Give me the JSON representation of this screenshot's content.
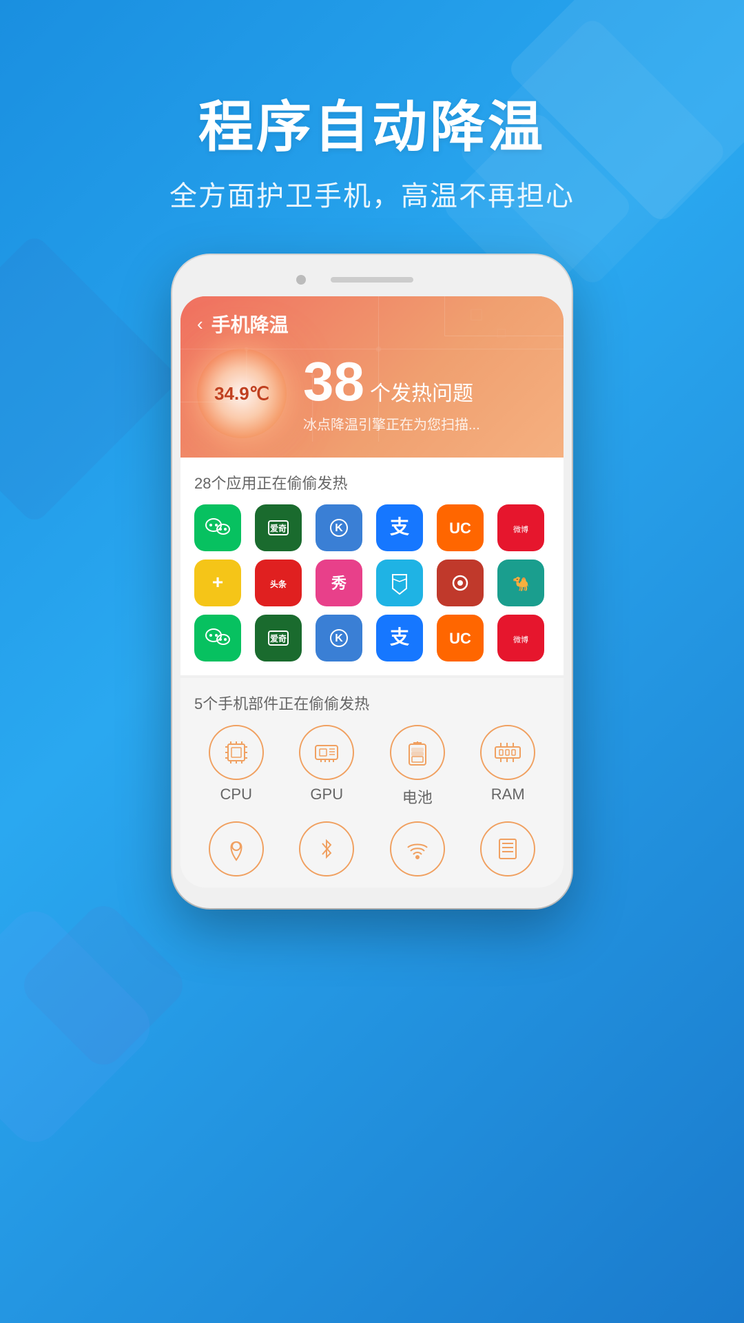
{
  "background": {
    "gradient_start": "#1a8fe0",
    "gradient_end": "#1a7acc"
  },
  "hero": {
    "title": "程序自动降温",
    "subtitle": "全方面护卫手机，高温不再担心"
  },
  "phone": {
    "header": {
      "back_label": "‹",
      "title": "手机降温",
      "temperature": "34.9℃",
      "issue_count": "38",
      "issue_label": "个发热问题",
      "issue_desc": "冰点降温引擎正在为您扫描..."
    },
    "apps_section": {
      "title": "28个应用正在偷偷发热",
      "apps": [
        {
          "name": "wechat",
          "emoji": "💬",
          "color": "#07c160"
        },
        {
          "name": "iqiyi",
          "emoji": "📺",
          "color": "#1a6b2e"
        },
        {
          "name": "kuwo",
          "emoji": "🎵",
          "color": "#3a7fd5"
        },
        {
          "name": "alipay",
          "emoji": "💳",
          "color": "#1677ff"
        },
        {
          "name": "uc",
          "emoji": "🌐",
          "color": "#ff6600"
        },
        {
          "name": "weibo",
          "emoji": "📱",
          "color": "#e6162d"
        },
        {
          "name": "jiankang",
          "emoji": "➕",
          "color": "#f5c518"
        },
        {
          "name": "toutiao",
          "emoji": "📰",
          "color": "#e02020"
        },
        {
          "name": "xiu",
          "emoji": "✨",
          "color": "#e8408a"
        },
        {
          "name": "maps",
          "emoji": "🗺",
          "color": "#1fb3e4"
        },
        {
          "name": "music",
          "emoji": "🎶",
          "color": "#c0392b"
        },
        {
          "name": "camel",
          "emoji": "🐪",
          "color": "#1a9e8e"
        },
        {
          "name": "wechat2",
          "emoji": "💬",
          "color": "#07c160"
        },
        {
          "name": "iqiyi2",
          "emoji": "📺",
          "color": "#1a6b2e"
        },
        {
          "name": "kuwo2",
          "emoji": "🎵",
          "color": "#3a7fd5"
        },
        {
          "name": "alipay2",
          "emoji": "💳",
          "color": "#1677ff"
        },
        {
          "name": "uc2",
          "emoji": "🌐",
          "color": "#ff6600"
        },
        {
          "name": "weibo2",
          "emoji": "📱",
          "color": "#e6162d"
        }
      ]
    },
    "components_section": {
      "title": "5个手机部件正在偷偷发热",
      "components": [
        {
          "name": "CPU",
          "icon": "cpu"
        },
        {
          "name": "GPU",
          "icon": "gpu"
        },
        {
          "name": "电池",
          "icon": "battery"
        },
        {
          "name": "RAM",
          "icon": "ram"
        }
      ],
      "bottom_icons": [
        {
          "name": "位置",
          "icon": "location"
        },
        {
          "name": "蓝牙",
          "icon": "bluetooth"
        },
        {
          "name": "WiFi",
          "icon": "wifi"
        },
        {
          "name": "存储",
          "icon": "storage"
        }
      ]
    }
  },
  "accent_color": "#f0a060"
}
